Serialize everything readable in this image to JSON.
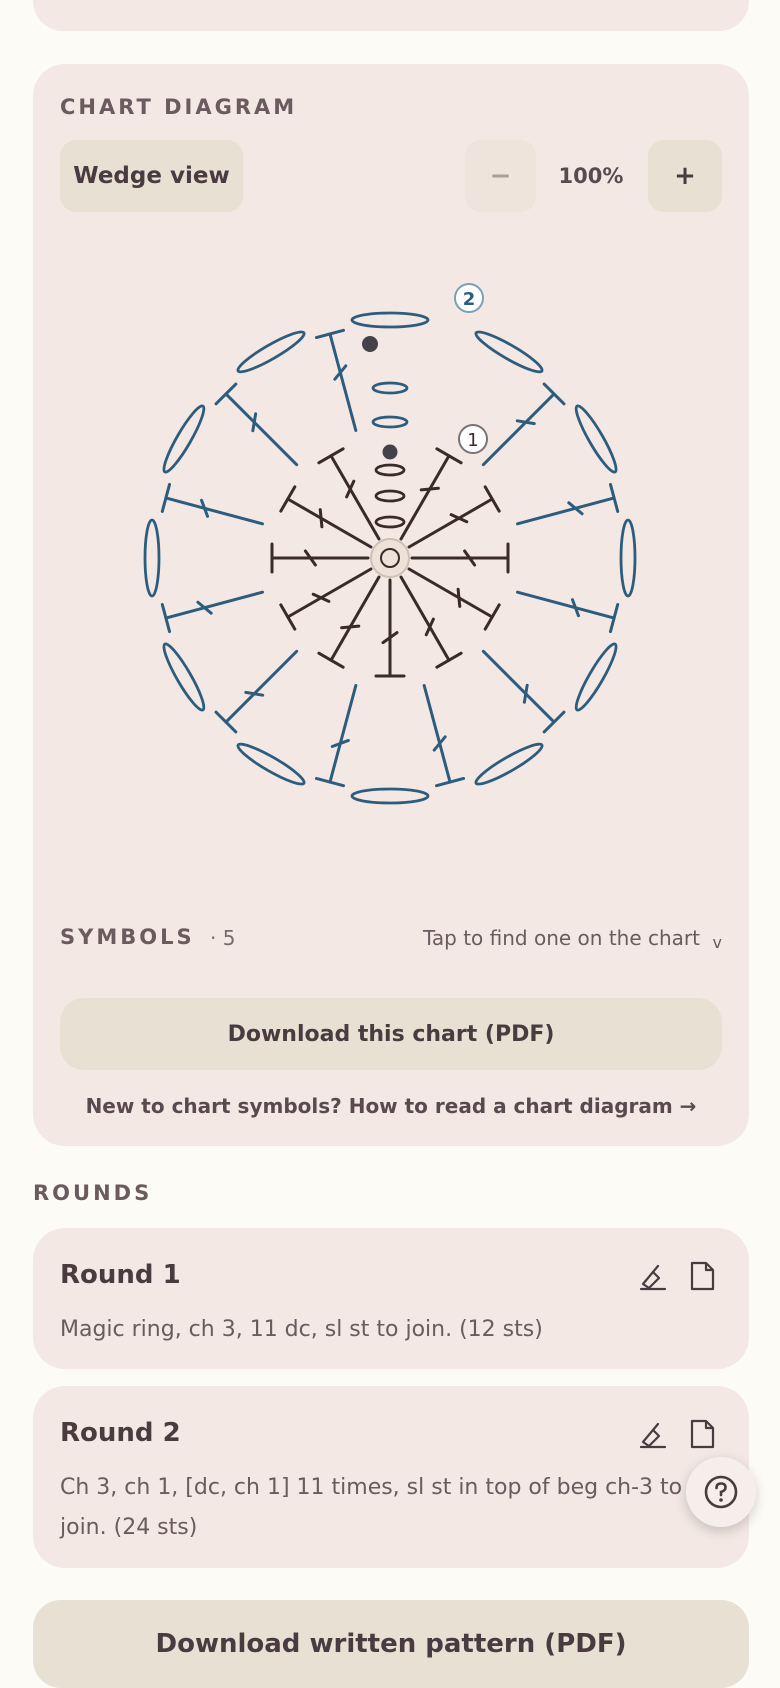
{
  "chart_section": {
    "label": "CHART DIAGRAM",
    "wedge_button": "Wedge view",
    "zoom_minus": "−",
    "zoom_level": "100%",
    "zoom_plus": "+",
    "round_markers": [
      "1",
      "2"
    ],
    "colors": {
      "round1": "#3a2a28",
      "round2": "#2d5d7e",
      "marker": "#45414a"
    }
  },
  "symbols": {
    "label": "SYMBOLS",
    "count": "· 5",
    "hint": "Tap to find one on the chart",
    "hint_chevron": "v"
  },
  "download_chart_label": "Download this chart (PDF)",
  "how_to_link": "New to chart symbols? How to read a chart diagram →",
  "rounds": {
    "label": "ROUNDS",
    "items": [
      {
        "title": "Round 1",
        "text": "Magic ring, ch 3, 11 dc, sl st to join. (12 sts)"
      },
      {
        "title": "Round 2",
        "text": "Ch 3, ch 1, [dc, ch 1] 11 times, sl st in top of beg ch-3 to join. (24 sts)"
      }
    ]
  },
  "help_icon": "question-circle-icon",
  "download_written_label": "Download written pattern (PDF)"
}
